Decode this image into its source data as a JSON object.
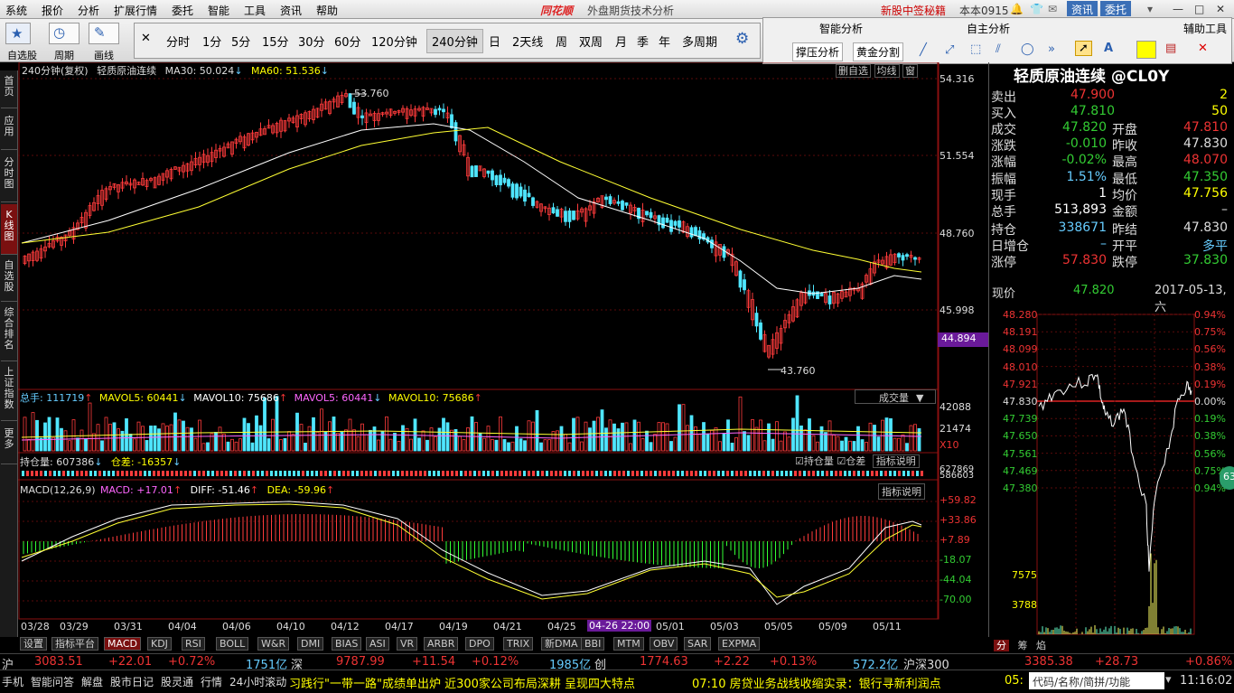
{
  "menu": [
    "系统",
    "报价",
    "分析",
    "扩展行情",
    "委托",
    "智能",
    "工具",
    "资讯",
    "帮助"
  ],
  "app_logo": "同花顺",
  "app_subtitle": "外盘期货技术分析",
  "top_right": {
    "promo": "新股中签秘籍",
    "version": "本本0915",
    "info_btn": "资讯",
    "trade_btn": "委托"
  },
  "toolbar": {
    "groups": [
      "自选股",
      "周期",
      "画线"
    ],
    "periods": [
      "分时",
      "1分",
      "5分",
      "15分",
      "30分",
      "60分",
      "120分钟",
      "240分钟",
      "日",
      "2天线",
      "周",
      "双周",
      "月",
      "季",
      "年",
      "多周期"
    ],
    "smart_title": "智能分析",
    "smart_btns": [
      "撑压分析",
      "黄金分割"
    ],
    "draw_title": "自主分析",
    "aux_title": "辅助工具"
  },
  "leftnav": [
    "首页",
    "应用",
    "分时图",
    "K线图",
    "自选股",
    "综合排名",
    "上证指数",
    "更多"
  ],
  "kline": {
    "header": {
      "period": "240分钟(复权)",
      "name": "轻质原油连续",
      "ma30_label": "MA30: 50.024",
      "ma60_label": "MA60: 51.536"
    },
    "yticks": [
      "54.316",
      "51.554",
      "48.760",
      "45.998"
    ],
    "price_tag": "44.894",
    "high_label": "53.760",
    "low_label": "43.760",
    "corner_btns": [
      "删自选",
      "均线",
      "窗"
    ]
  },
  "volume": {
    "header": {
      "total": "总手: 111719",
      "mavol5": "MAVOL5: 60441",
      "mavol10": "MAVOL10: 75686",
      "mavol5b": "MAVOL5: 60441",
      "mavol10b": "MAVOL10: 75686"
    },
    "dropdown": "成交量",
    "yticks": [
      "42088",
      "21474",
      "X10"
    ]
  },
  "oi": {
    "header": {
      "hold": "持仓量: 607386",
      "diff": "仓差: -16357"
    },
    "checks": [
      "持仓量",
      "仓差"
    ],
    "btn": "指标说明",
    "yticks": [
      "627869",
      "586603"
    ]
  },
  "macd": {
    "header": {
      "name": "MACD(12,26,9)",
      "macd": "MACD: +17.01",
      "diff": "DIFF: -51.46",
      "dea": "DEA: -59.96"
    },
    "btn": "指标说明",
    "yticks": [
      "+59.82",
      "+33.86",
      "+7.89",
      "-18.07",
      "-44.04",
      "-70.00"
    ]
  },
  "xaxis": [
    "03/28",
    "03/29",
    "03/31",
    "04/04",
    "04/06",
    "04/10",
    "04/12",
    "04/17",
    "04/19",
    "04/21",
    "04/25",
    "04-26 22:00",
    "05/01",
    "05/03",
    "05/05",
    "05/09",
    "05/11"
  ],
  "bottom_tabs": [
    "设置",
    "指标平台",
    "MACD",
    "KDJ",
    "RSI",
    "BOLL",
    "W&R",
    "DMI",
    "BIAS",
    "ASI",
    "VR",
    "ARBR",
    "DPO",
    "TRIX",
    "新DMA",
    "BBI",
    "MTM",
    "OBV",
    "SAR",
    "EXPMA"
  ],
  "quote": {
    "title": "轻质原油连续 @CL0Y",
    "sell": {
      "label": "卖出",
      "price": "47.900",
      "vol": "2"
    },
    "buy": {
      "label": "买入",
      "price": "47.810",
      "vol": "50"
    },
    "rows": [
      {
        "l1": "成交",
        "v1": "47.820",
        "l2": "开盘",
        "v2": "47.810"
      },
      {
        "l1": "涨跌",
        "v1": "-0.010",
        "l2": "昨收",
        "v2": "47.830"
      },
      {
        "l1": "涨幅",
        "v1": "-0.02%",
        "l2": "最高",
        "v2": "48.070"
      },
      {
        "l1": "振幅",
        "v1": "1.51%",
        "l2": "最低",
        "v2": "47.350"
      },
      {
        "l1": "现手",
        "v1": "1",
        "l2": "均价",
        "v2": "47.756"
      },
      {
        "l1": "总手",
        "v1": "513,893",
        "l2": "金额",
        "v2": "–"
      },
      {
        "l1": "持仓",
        "v1": "338671",
        "l2": "昨结",
        "v2": "47.830"
      },
      {
        "l1": "日增仓",
        "v1": "–",
        "l2": "开平",
        "v2": "多平"
      },
      {
        "l1": "涨停",
        "v1": "57.830",
        "l2": "跌停",
        "v2": "37.830"
      }
    ]
  },
  "mini": {
    "label": "现价",
    "price": "47.820",
    "date": "2017-05-13,六",
    "left": [
      "48.280",
      "48.191",
      "48.099",
      "48.010",
      "47.921",
      "47.830",
      "47.739",
      "47.650",
      "47.561",
      "47.469",
      "47.380"
    ],
    "right": [
      "0.94%",
      "0.75%",
      "0.56%",
      "0.38%",
      "0.19%",
      "0.00%",
      "0.19%",
      "0.38%",
      "0.56%",
      "0.75%",
      "0.94%"
    ],
    "vol": [
      "7575",
      "3788"
    ],
    "tabs": [
      "分",
      "筹",
      "焰"
    ]
  },
  "status": {
    "sh": {
      "label": "沪",
      "value": "3083.51",
      "chg": "+22.01",
      "pct": "+0.72%",
      "amt": "1751亿"
    },
    "sz": {
      "label": "深",
      "value": "9787.99",
      "chg": "+11.54",
      "pct": "+0.12%",
      "amt": "1985亿"
    },
    "cy": {
      "label": "创",
      "value": "1774.63",
      "chg": "+2.22",
      "pct": "+0.13%",
      "amt": "572.2亿"
    },
    "hs": {
      "label": "沪深300",
      "value": "3385.38",
      "chg": "+28.73",
      "pct": "+0.86%"
    },
    "tabs": [
      "手机",
      "智能问答",
      "解盘",
      "股市日记",
      "股灵通",
      "行情",
      "24小时滚动"
    ],
    "news1": "习践行\"一带一路\"成绩单出炉 近300家公司布局深耕 呈现四大特点",
    "news2": "07:10 房贷业务战线收缩实录：银行寻新利润点",
    "clock_prefix": "05:",
    "search": "代码/名称/简拼/功能",
    "time": "11:16:02"
  }
}
